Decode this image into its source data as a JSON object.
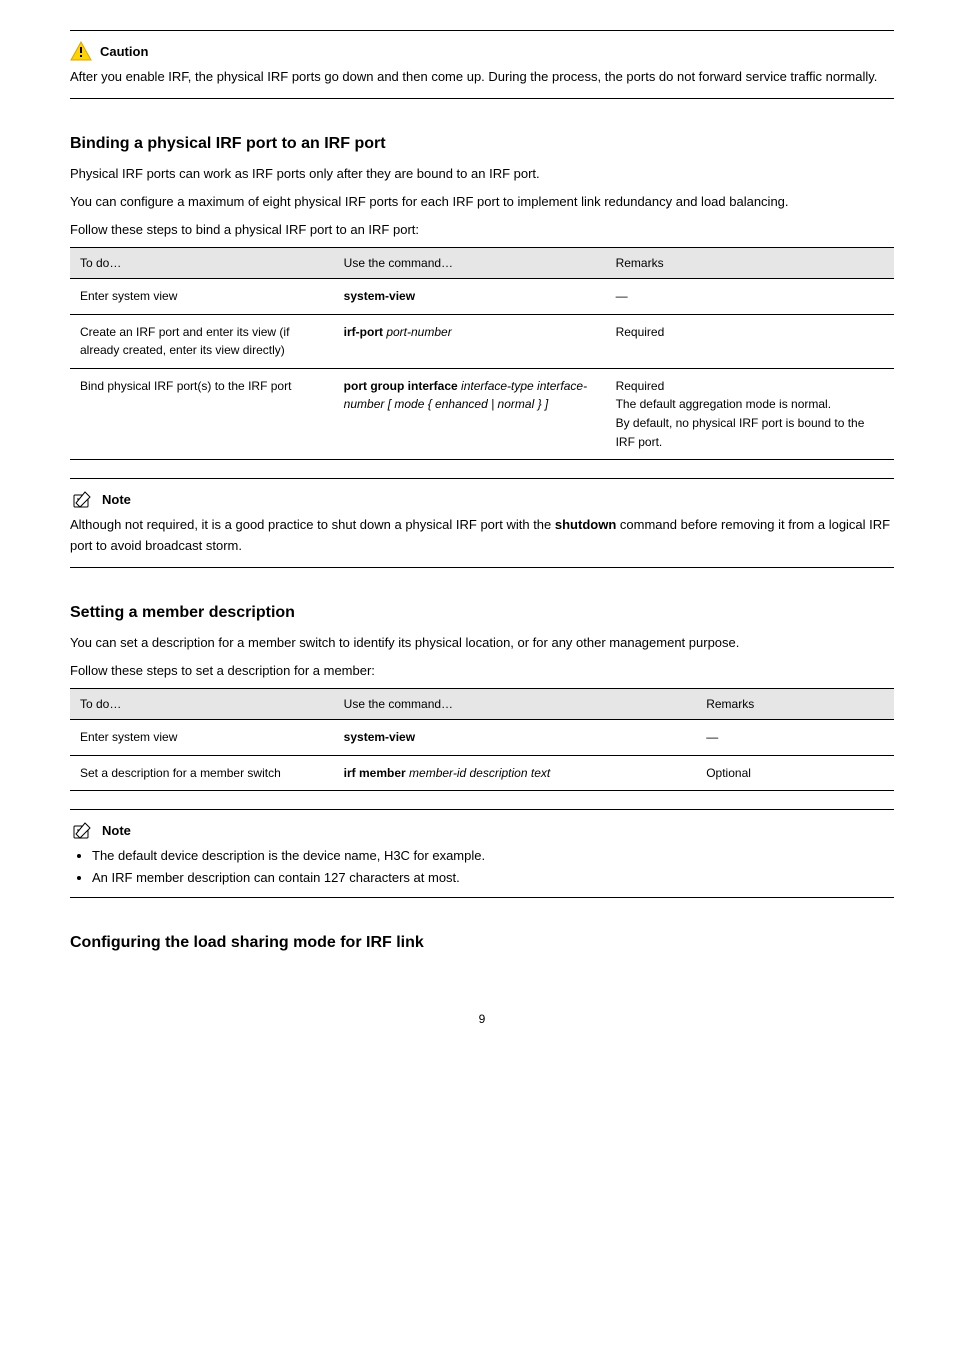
{
  "callouts": {
    "caution": {
      "label": "Caution",
      "body": "After you enable IRF, the physical IRF ports go down and then come up. During the process, the ports do not forward service traffic normally."
    },
    "note1": {
      "label": "Note",
      "body_prefix": "Although not required, it is a good practice to shut down a physical IRF port with the ",
      "body_cmd": "shutdown",
      "body_suffix": " command before removing it from a logical IRF port to avoid broadcast storm."
    },
    "note2": {
      "label": "Note",
      "bullets": [
        "The default device description is the device name, H3C for example.",
        "An IRF member description can contain 127 characters at most."
      ]
    }
  },
  "sections": {
    "binding": {
      "title": "Binding a physical IRF port to an IRF port",
      "para1": "Physical IRF ports can work as IRF ports only after they are bound to an IRF port.",
      "para2": "You can configure a maximum of eight physical IRF ports for each IRF port to implement link redundancy and load balancing.",
      "para3": "Follow these steps to bind a physical IRF port to an IRF port:",
      "table_caption": "",
      "table": {
        "headers": [
          "To do…",
          "Use the command…",
          "Remarks"
        ],
        "rows": [
          {
            "c1": "Enter system view",
            "c2_cmd": "system-view",
            "c2_rest": "",
            "c3": "—"
          },
          {
            "c1": "Create an IRF port and enter its view (if already created, enter its view directly)",
            "c2_cmd": "irf-port",
            "c2_rest": " port-number",
            "c3": "Required"
          },
          {
            "c1": "Bind physical IRF port(s) to the IRF port",
            "c2_cmd": "port group interface",
            "c2_rest": " interface-type interface-number [ mode { enhanced | normal } ]",
            "c3": "Required\nThe default aggregation mode is normal.\nBy default, no physical IRF port is bound to the IRF port."
          }
        ]
      }
    },
    "description": {
      "title": "Setting a member description",
      "para1": "You can set a description for a member switch to identify its physical location, or for any other management purpose.",
      "para2": "Follow these steps to set a description for a member:",
      "table": {
        "headers": [
          "To do…",
          "Use the command…",
          "Remarks"
        ],
        "rows": [
          {
            "c1": "Enter system view",
            "c2_cmd": "system-view",
            "c2_rest": "",
            "c3": "—"
          },
          {
            "c1": "Set a description for a member switch",
            "c2_cmd": "irf member",
            "c2_rest": " member-id description text",
            "c3": "Optional"
          }
        ]
      }
    },
    "loadsharing": {
      "title": "Configuring the load sharing mode for IRF link"
    }
  },
  "page_number": "9"
}
